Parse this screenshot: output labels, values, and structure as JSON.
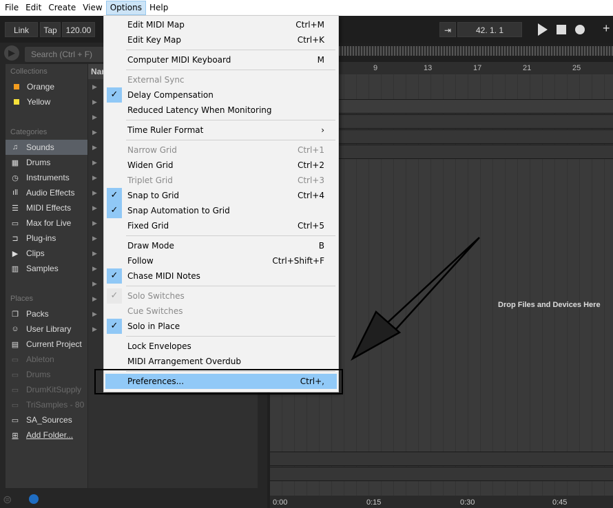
{
  "menubar": {
    "items": [
      "File",
      "Edit",
      "Create",
      "View",
      "Options",
      "Help"
    ],
    "active": "Options"
  },
  "toolbar": {
    "link": "Link",
    "tap": "Tap",
    "tempo": "120.00",
    "position": "42.  1.  1"
  },
  "search": {
    "placeholder": "Search (Ctrl + F)"
  },
  "browser": {
    "collections_header": "Collections",
    "collections": [
      {
        "label": "Orange",
        "color": "#f39c1f"
      },
      {
        "label": "Yellow",
        "color": "#f7e13a"
      }
    ],
    "categories_header": "Categories",
    "categories": [
      "Sounds",
      "Drums",
      "Instruments",
      "Audio Effects",
      "MIDI Effects",
      "Max for Live",
      "Plug-ins",
      "Clips",
      "Samples"
    ],
    "places_header": "Places",
    "places": [
      "Packs",
      "User Library",
      "Current Project",
      "Ableton",
      "Drums",
      "DrumKitSupply",
      "TriSamples - 80",
      "SA_Sources",
      "Add Folder..."
    ],
    "names_header": "Nar"
  },
  "ruler": [
    "9",
    "13",
    "17",
    "21",
    "25"
  ],
  "timeline": [
    "0:00",
    "0:15",
    "0:30",
    "0:45"
  ],
  "drop_text": "Drop Files and Devices Here",
  "menu": [
    {
      "label": "Edit MIDI Map",
      "shortcut": "Ctrl+M"
    },
    {
      "label": "Edit Key Map",
      "shortcut": "Ctrl+K"
    },
    {
      "label": "Computer MIDI Keyboard",
      "shortcut": "M"
    },
    {
      "label": "External Sync",
      "shortcut": ""
    },
    {
      "label": "Delay Compensation",
      "shortcut": ""
    },
    {
      "label": "Reduced Latency When Monitoring",
      "shortcut": ""
    },
    {
      "label": "Time Ruler Format",
      "shortcut": "›"
    },
    {
      "label": "Narrow Grid",
      "shortcut": "Ctrl+1"
    },
    {
      "label": "Widen Grid",
      "shortcut": "Ctrl+2"
    },
    {
      "label": "Triplet Grid",
      "shortcut": "Ctrl+3"
    },
    {
      "label": "Snap to Grid",
      "shortcut": "Ctrl+4"
    },
    {
      "label": "Snap Automation to Grid",
      "shortcut": ""
    },
    {
      "label": "Fixed Grid",
      "shortcut": "Ctrl+5"
    },
    {
      "label": "Draw Mode",
      "shortcut": "B"
    },
    {
      "label": "Follow",
      "shortcut": "Ctrl+Shift+F"
    },
    {
      "label": "Chase MIDI Notes",
      "shortcut": ""
    },
    {
      "label": "Solo Switches",
      "shortcut": ""
    },
    {
      "label": "Cue Switches",
      "shortcut": ""
    },
    {
      "label": "Solo in Place",
      "shortcut": ""
    },
    {
      "label": "Lock Envelopes",
      "shortcut": ""
    },
    {
      "label": "MIDI Arrangement Overdub",
      "shortcut": ""
    },
    {
      "label": "Preferences...",
      "shortcut": "Ctrl+,"
    }
  ],
  "checkmark": "✓"
}
